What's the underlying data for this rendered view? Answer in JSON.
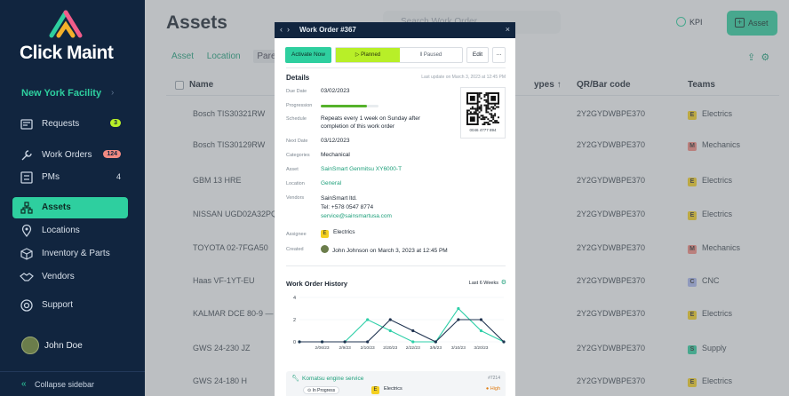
{
  "app": {
    "name": "Click Maint"
  },
  "sidebar": {
    "facility": "New York Facility",
    "items": [
      {
        "label": "Requests",
        "badge": "3",
        "icon": "requests-icon"
      },
      {
        "label": "Work Orders",
        "badge": "124",
        "icon": "wrench-icon"
      },
      {
        "label": "PMs",
        "count": "4",
        "icon": "pm-icon"
      },
      {
        "label": "Assets",
        "icon": "assets-icon",
        "active": true
      },
      {
        "label": "Locations",
        "icon": "location-pin-icon"
      },
      {
        "label": "Inventory & Parts",
        "icon": "box-icon"
      },
      {
        "label": "Vendors",
        "icon": "handshake-icon"
      },
      {
        "label": "Support",
        "icon": "support-icon"
      }
    ],
    "user": "John Doe",
    "collapse_label": "Collapse sidebar"
  },
  "main": {
    "title": "Assets",
    "search_placeholder": "Search Work Order",
    "kpi_label": "KPI",
    "add_label": "Asset",
    "subtabs": [
      "Asset",
      "Location",
      "Parent"
    ],
    "columns": {
      "name": "Name",
      "types": "ypes",
      "qr": "QR/Bar code",
      "teams": "Teams"
    },
    "rows": [
      {
        "name": "Bosch TIS30321RW",
        "qr": "2Y2GYDWBPE370",
        "team": "Electrics",
        "tag": "E"
      },
      {
        "name": "Bosch TIS30129RW",
        "qr": "2Y2GYDWBPE370",
        "team": "Mechanics",
        "tag": "M"
      },
      {
        "name": "GBM 13 HRE",
        "qr": "2Y2GYDWBPE370",
        "team": "Electrics",
        "tag": "E"
      },
      {
        "name": "NISSAN UGD02A32PQ",
        "qr": "2Y2GYDWBPE370",
        "team": "Electrics",
        "tag": "E"
      },
      {
        "name": "TOYOTA 02-7FGA50",
        "qr": "2Y2GYDWBPE370",
        "team": "Mechanics",
        "tag": "M"
      },
      {
        "name": "Haas VF-1YT-EU",
        "qr": "2Y2GYDWBPE370",
        "team": "CNC",
        "tag": "C"
      },
      {
        "name": "KALMAR DCE 80-9 —",
        "qr": "2Y2GYDWBPE370",
        "team": "Electrics",
        "tag": "E"
      },
      {
        "name": "GWS 24-230 JZ",
        "qr": "2Y2GYDWBPE370",
        "team": "Supply",
        "tag": "S"
      },
      {
        "name": "GWS 24-180 H",
        "qr": "2Y2GYDWBPE370",
        "team": "Electrics",
        "tag": "E"
      }
    ],
    "colors": {
      "E": "#f4d020",
      "M": "#f28a82",
      "C": "#a9b7f0",
      "S": "#2ecf9f"
    }
  },
  "modal": {
    "title": "Work Order #367",
    "activate_label": "Activate Now",
    "planned_label": "Planned",
    "paused_label": "Paused",
    "edit_label": "Edit",
    "more_label": "...",
    "details_heading": "Details",
    "last_update": "Last update on March 3, 2023 at 12:45 PM",
    "fields": {
      "due_date_label": "Due Date",
      "due_date": "03/02/2023",
      "progression_label": "Progression",
      "progression": 0.8,
      "schedule_label": "Schedule",
      "schedule_line1": "Repeats every 1 week on Sunday after",
      "schedule_line2": "completion of this work order",
      "next_date_label": "Next Date",
      "next_date": "03/12/2023",
      "categories_label": "Categories",
      "categories": "Mechanical",
      "asset_label": "Asset",
      "asset": "SainSmart Genmitsu XY6000-T",
      "location_label": "Location",
      "location": "General",
      "vendors_label": "Vendors",
      "vendor_name": "SainSmart ltd.",
      "vendor_tel": "Tel: +578 0547 8774",
      "vendor_email": "service@sainsmartusa.com",
      "assignee_label": "Assignee",
      "assignee": "Electrics",
      "assignee_tag": "E",
      "created_label": "Created",
      "created": "John Johnson on March 3, 2023 at 12:45 PM"
    },
    "qr_number": "0046 4777 894",
    "history_heading": "Work Order History",
    "history_range": "Last 6 Weeks",
    "card": {
      "title": "Komatsu engine service",
      "id": "#7214",
      "status": "In Progress",
      "team": "Electrics",
      "team_tag": "E",
      "priority": "High"
    }
  },
  "chart_data": {
    "type": "line",
    "categories": [
      "2/06/23",
      "2/9/23",
      "2/10/23",
      "2/20/23",
      "2/22/23",
      "3/6/23",
      "3/10/23",
      "3/20/23"
    ],
    "ylim": [
      0,
      4
    ],
    "yticks": [
      0,
      2,
      4
    ],
    "grid": true,
    "series": [
      {
        "color": "#2ecfa8",
        "values": [
          0,
          0,
          0,
          2,
          1,
          0,
          0,
          3,
          1,
          0
        ]
      },
      {
        "color": "#1f3350",
        "values": [
          0,
          0,
          0,
          0,
          2,
          1,
          0,
          2,
          2,
          0
        ]
      }
    ]
  }
}
